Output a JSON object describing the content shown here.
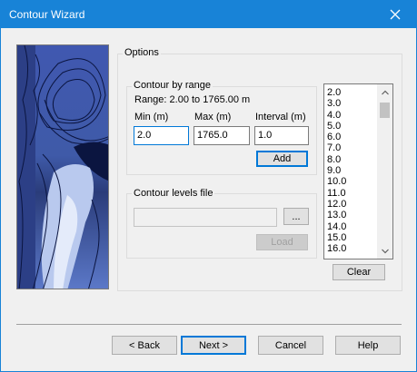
{
  "window": {
    "title": "Contour Wizard"
  },
  "options": {
    "label": "Options"
  },
  "contour_by_range": {
    "label": "Contour by range",
    "range_text": "Range:  2.00 to 1765.00 m",
    "min_label": "Min (m)",
    "max_label": "Max (m)",
    "interval_label": "Interval (m)",
    "min_value": "2.0",
    "max_value": "1765.0",
    "interval_value": "1.0",
    "add_label": "Add"
  },
  "contour_file": {
    "label": "Contour levels file",
    "path_value": "",
    "browse_label": "...",
    "load_label": "Load"
  },
  "levels": {
    "items": [
      "2.0",
      "3.0",
      "4.0",
      "5.0",
      "6.0",
      "7.0",
      "8.0",
      "9.0",
      "10.0",
      "11.0",
      "12.0",
      "13.0",
      "14.0",
      "15.0",
      "16.0"
    ],
    "clear_label": "Clear"
  },
  "footer": {
    "back_label": "< Back",
    "next_label": "Next >",
    "cancel_label": "Cancel",
    "help_label": "Help"
  },
  "colors": {
    "accent": "#1883d7",
    "focus": "#0078d7"
  }
}
